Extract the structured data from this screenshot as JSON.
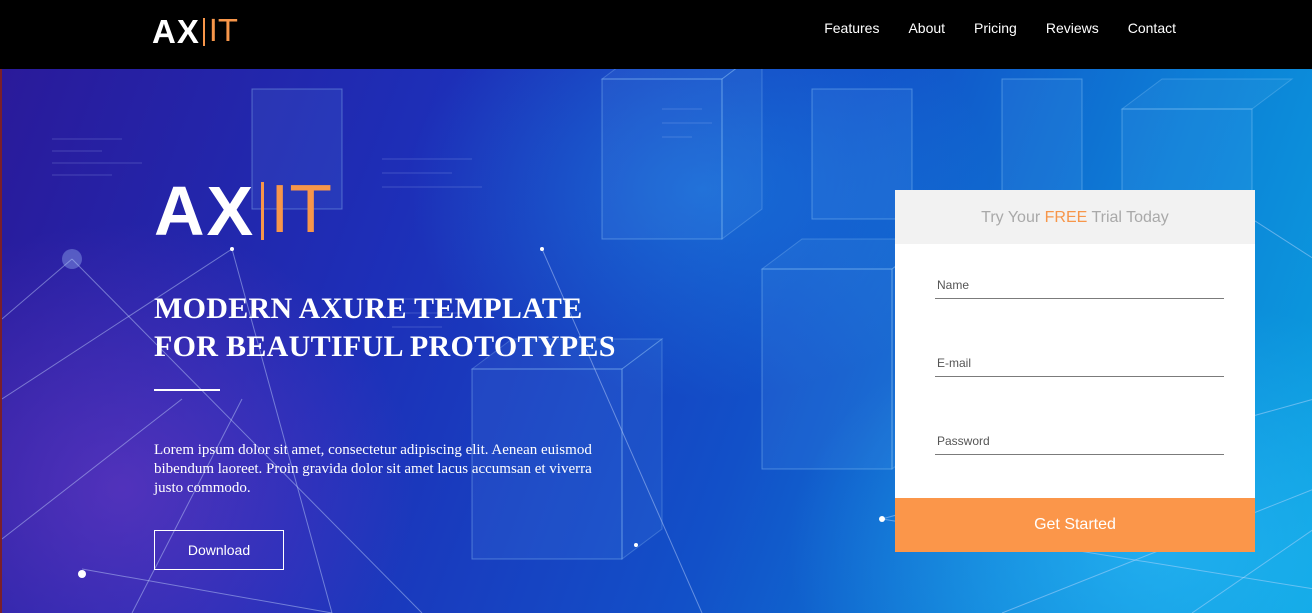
{
  "brand": {
    "main": "AX",
    "accent": "IT",
    "accent_color": "#f7964a"
  },
  "nav": {
    "items": [
      {
        "label": "Features"
      },
      {
        "label": "About"
      },
      {
        "label": "Pricing"
      },
      {
        "label": "Reviews"
      },
      {
        "label": "Contact"
      }
    ]
  },
  "hero": {
    "headline_line1": "MODERN AXURE TEMPLATE",
    "headline_line2": "FOR BEAUTIFUL PROTOTYPES",
    "lede": "Lorem ipsum dolor sit amet, consectetur adipiscing elit. Aenean euismod bibendum laoreet. Proin gravida dolor sit amet lacus accumsan et viverra justo commodo.",
    "download_label": "Download"
  },
  "trial_form": {
    "title_before": "Try Your ",
    "title_highlight": "FREE",
    "title_after": " Trial Today",
    "name_placeholder": "Name",
    "email_placeholder": "E-mail",
    "password_placeholder": "Password",
    "submit_label": "Get Started",
    "button_color": "#fb964a"
  }
}
